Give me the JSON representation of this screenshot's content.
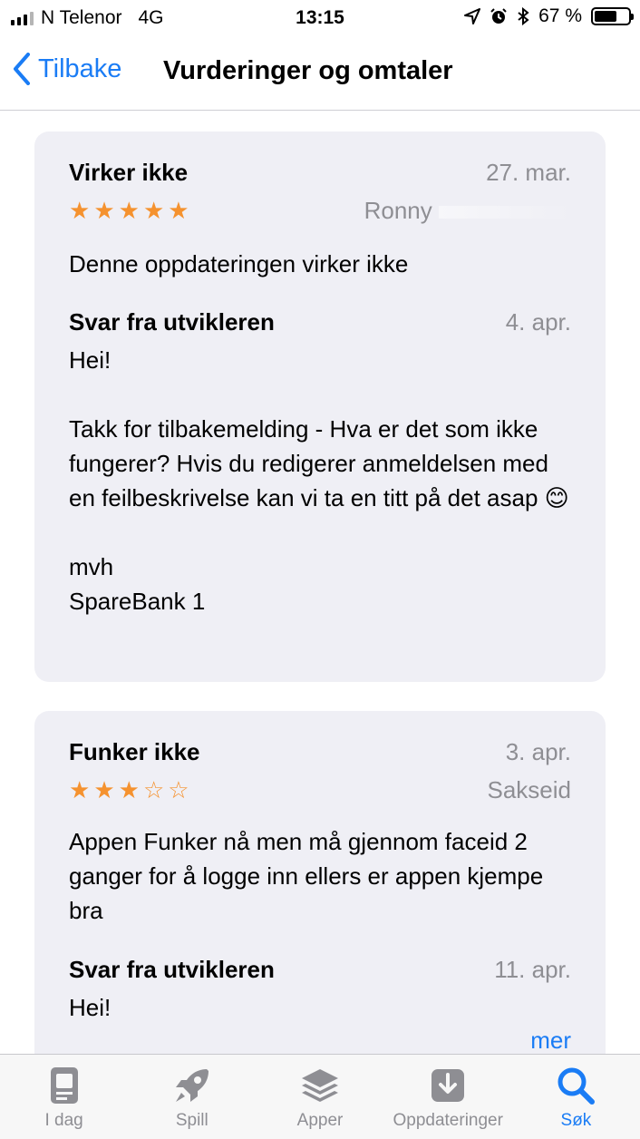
{
  "status_bar": {
    "carrier": "N Telenor",
    "network": "4G",
    "time": "13:15",
    "battery": "67 %",
    "battery_level": 0.67
  },
  "nav": {
    "back_label": "Tilbake",
    "title": "Vurderinger og omtaler"
  },
  "reviews": [
    {
      "title": "Virker ikke",
      "date": "27. mar.",
      "rating": 5,
      "author": "Ronny",
      "body": "Denne oppdateringen virker ikke",
      "developer_response": {
        "title": "Svar fra utvikleren",
        "date": "4. apr.",
        "text": "Hei!\n\nTakk for tilbakemelding - Hva er det som ikke fungerer? Hvis du redigerer anmeldelsen med en feilbeskrivelse kan vi ta en titt på det asap 😊\n\nmvh\nSpareBank 1"
      }
    },
    {
      "title": "Funker ikke",
      "date": "3. apr.",
      "rating": 3,
      "author": "Sakseid",
      "body": "Appen Funker nå men må gjennom faceid 2 ganger for å logge inn ellers er appen kjempe bra",
      "developer_response": {
        "title": "Svar fra utvikleren",
        "date": "11. apr.",
        "text": "Hei!"
      },
      "more_label": "mer"
    }
  ],
  "tabbar": {
    "tabs": [
      {
        "label": "I dag",
        "icon": "today-icon"
      },
      {
        "label": "Spill",
        "icon": "rocket-icon"
      },
      {
        "label": "Apper",
        "icon": "layers-icon"
      },
      {
        "label": "Oppdateringer",
        "icon": "download-icon"
      },
      {
        "label": "Søk",
        "icon": "search-icon"
      }
    ],
    "active": "Søk"
  },
  "colors": {
    "accent": "#1a7cf5",
    "star": "#f5922f",
    "card": "#efeff5",
    "secondary_text": "#8e8e93"
  }
}
